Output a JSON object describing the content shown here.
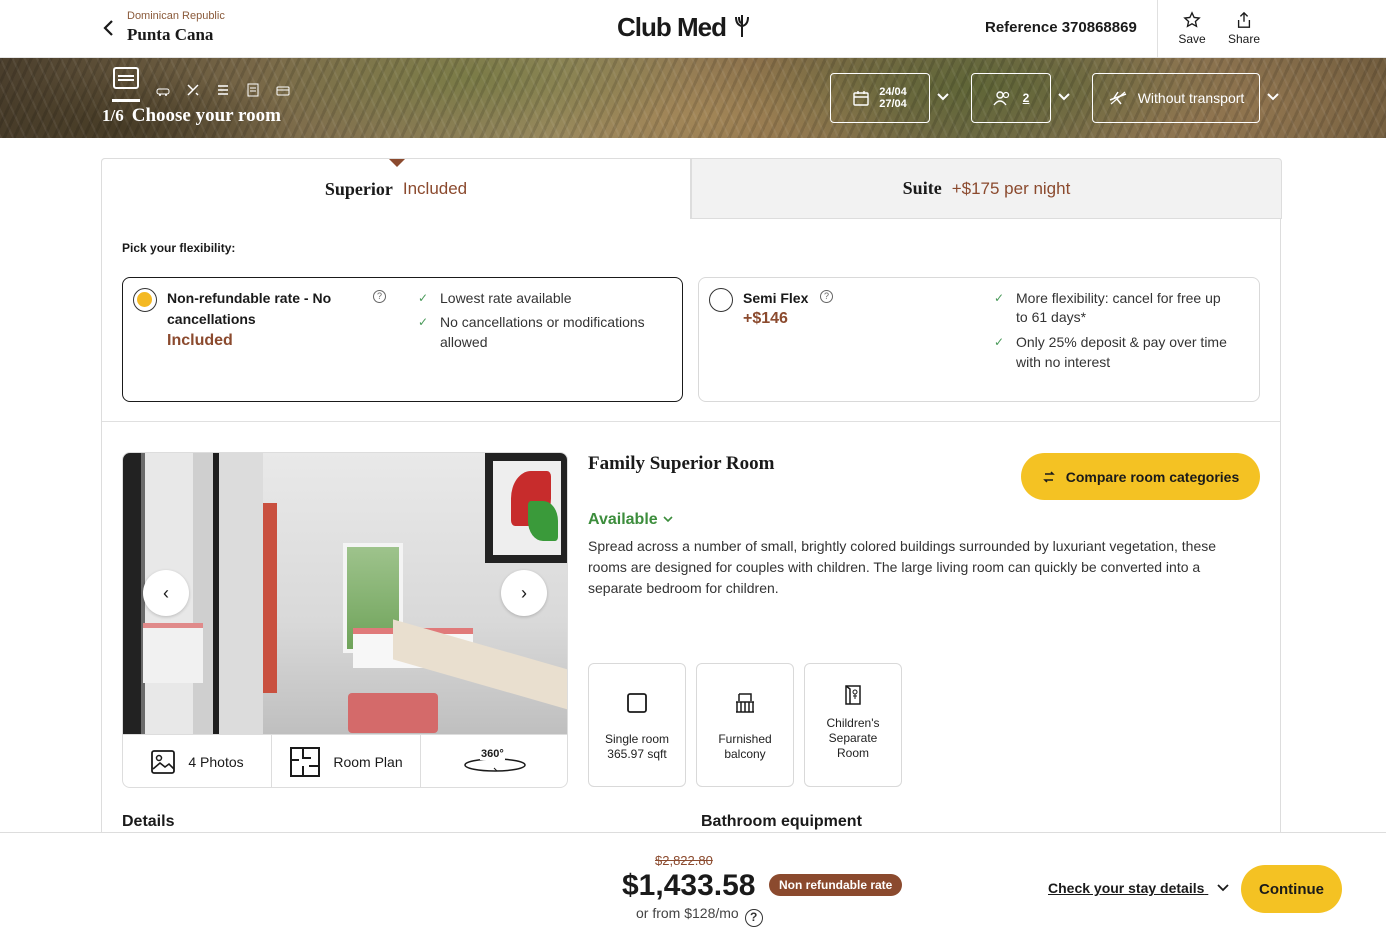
{
  "header": {
    "country": "Dominican Republic",
    "city": "Punta Cana",
    "logo": "Club Med",
    "reference": "Reference 370868869",
    "save_label": "Save",
    "share_label": "Share"
  },
  "hero": {
    "step_number": "1/6",
    "step_title": "Choose your room",
    "date_from": "24/04",
    "date_to": "27/04",
    "guests": "2",
    "transport": "Without transport"
  },
  "tabs": [
    {
      "name": "Superior",
      "price": "Included",
      "active": true
    },
    {
      "name": "Suite",
      "price": "+$175 per night",
      "active": false
    }
  ],
  "flexibility": {
    "label": "Pick your flexibility:",
    "options": [
      {
        "name_line1": "Non-refundable rate - No",
        "name_line2": "cancellations",
        "price": "Included",
        "selected": true,
        "features": [
          "Lowest rate available",
          "No cancellations or modifications",
          "allowed"
        ]
      },
      {
        "name_line1": "Semi Flex",
        "price": "+$146",
        "selected": false,
        "features": [
          "More flexibility: cancel for free up",
          "to 61 days*",
          "Only 25% deposit & pay over time",
          "with no interest"
        ]
      }
    ]
  },
  "room": {
    "title": "Family Superior Room",
    "compare_label": "Compare room categories",
    "availability": "Available",
    "description": "Spread across a number of small, brightly colored buildings surrounded by luxuriant vegetation, these rooms are designed for couples with children. The large living room can quickly be converted into a separate bedroom for children.",
    "gallery_tabs": {
      "photos": "4 Photos",
      "plan": "Room Plan",
      "tour": "360°"
    },
    "amenities": [
      {
        "line1": "Single room",
        "line2": "365.97 sqft"
      },
      {
        "line1": "Furnished",
        "line2": "balcony"
      },
      {
        "line1": "Children's",
        "line2": "Separate",
        "line3": "Room"
      }
    ],
    "sections": {
      "details": "Details",
      "bathroom": "Bathroom equipment"
    }
  },
  "footer": {
    "old_price": "$2,822.80",
    "price": "$1,433.58",
    "badge": "Non refundable rate",
    "monthly": "or from $128/mo",
    "check_stay": "Check your stay details",
    "continue_label": "Continue"
  },
  "colors": {
    "accent": "#f4c223",
    "brand_brown": "#8b4a2e",
    "available_green": "#3c8d3c"
  }
}
